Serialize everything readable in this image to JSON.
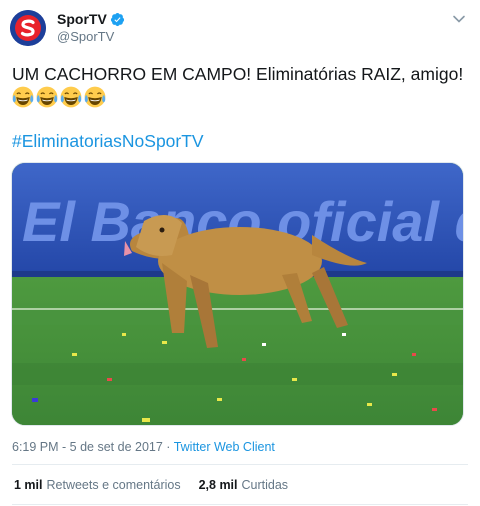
{
  "author": {
    "display_name": "SporTV",
    "handle": "@SporTV",
    "verified": true,
    "avatar_icon": "sportv-logo"
  },
  "tweet": {
    "text": "UM CACHORRO EM CAMPO! Eliminatórias RAIZ, amigo!",
    "emojis": [
      "😂",
      "😂",
      "😂",
      "😂"
    ],
    "hashtag": "#EliminatoriasNoSporTV"
  },
  "media": {
    "banner_text": "El Banco oficial de n"
  },
  "meta": {
    "time": "6:19 PM",
    "separator1": " - ",
    "date": "5 de set de 2017",
    "separator2": " · ",
    "client": "Twitter Web Client"
  },
  "stats": {
    "retweets_count": "1 mil",
    "retweets_label": "Retweets e comentários",
    "likes_count": "2,8 mil",
    "likes_label": "Curtidas"
  },
  "colors": {
    "link": "#1b95e0",
    "secondary": "#657786",
    "verified": "#1da1f2"
  }
}
